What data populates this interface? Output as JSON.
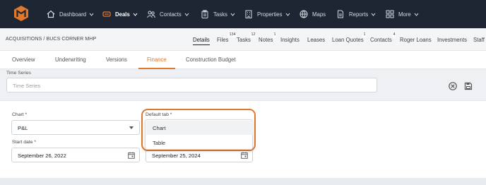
{
  "nav": {
    "items": [
      {
        "label": "Dashboard",
        "icon": "home-icon"
      },
      {
        "label": "Deals",
        "icon": "handshake-icon",
        "active": true
      },
      {
        "label": "Contacts",
        "icon": "contacts-icon"
      },
      {
        "label": "Tasks",
        "icon": "clipboard-icon"
      },
      {
        "label": "Properties",
        "icon": "building-icon"
      },
      {
        "label": "Maps",
        "icon": "globe-icon"
      },
      {
        "label": "Reports",
        "icon": "report-icon"
      },
      {
        "label": "More",
        "icon": "grid-icon"
      }
    ],
    "accent": "#e0782d"
  },
  "breadcrumb": "ACQUISITIONS / BUCS CORNER MHP",
  "deal_tabs": [
    {
      "label": "Details",
      "active": true
    },
    {
      "label": "Files",
      "badge": "134"
    },
    {
      "label": "Tasks",
      "badge": "12"
    },
    {
      "label": "Notes",
      "badge": "1"
    },
    {
      "label": "Insights"
    },
    {
      "label": "Leases"
    },
    {
      "label": "Loan Quotes",
      "badge": "1"
    },
    {
      "label": "Contacts",
      "badge": "4"
    },
    {
      "label": "Roger Loans"
    },
    {
      "label": "Investments"
    },
    {
      "label": "Staff"
    }
  ],
  "sub_tabs": [
    {
      "label": "Overview"
    },
    {
      "label": "Underwriting"
    },
    {
      "label": "Versions"
    },
    {
      "label": "Finance",
      "active": true
    },
    {
      "label": "Construction Budget"
    }
  ],
  "time_series": {
    "label": "Time Series",
    "placeholder": "Time Series"
  },
  "form": {
    "chart_label": "Chart *",
    "chart_value": "P&L",
    "default_tab_label": "Default tab *",
    "default_tab_options": [
      "Chart",
      "Table"
    ],
    "start_date_label": "Start date *",
    "start_date_value": "September 26, 2022",
    "end_date_value": "September 25, 2024"
  }
}
